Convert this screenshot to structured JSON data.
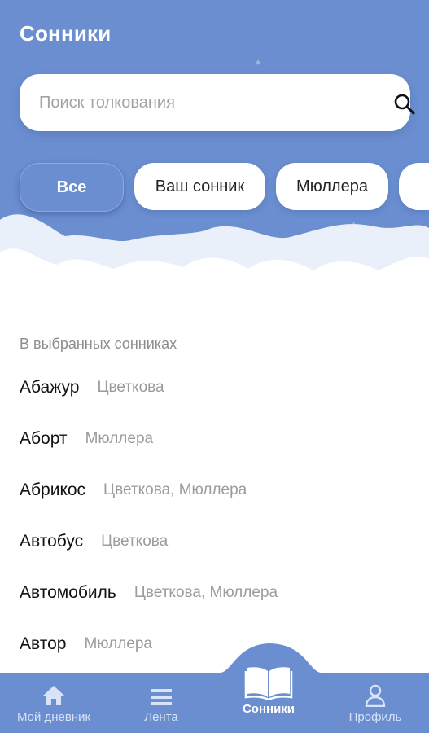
{
  "header": {
    "title": "Сонники"
  },
  "search": {
    "placeholder": "Поиск толкования",
    "icon": "search-icon"
  },
  "filters": {
    "items": [
      {
        "label": "Все",
        "active": true
      },
      {
        "label": "Ваш сонник",
        "active": false
      },
      {
        "label": "Мюллера",
        "active": false
      },
      {
        "label": "",
        "active": false
      }
    ]
  },
  "section": {
    "label": "В выбранных сонниках"
  },
  "entries": [
    {
      "word": "Абажур",
      "sources": "Цветкова"
    },
    {
      "word": "Аборт",
      "sources": "Мюллера"
    },
    {
      "word": "Абрикос",
      "sources": "Цветкова, Мюллера"
    },
    {
      "word": "Автобус",
      "sources": "Цветкова"
    },
    {
      "word": "Автомобиль",
      "sources": "Цветкова, Мюллера"
    },
    {
      "word": "Автор",
      "sources": "Мюллера"
    }
  ],
  "nav": {
    "items": [
      {
        "label": "Мой дневник",
        "icon": "home-icon",
        "active": false
      },
      {
        "label": "Лента",
        "icon": "feed-icon",
        "active": false
      },
      {
        "label": "Сонники",
        "icon": "book-icon",
        "active": true
      },
      {
        "label": "Профиль",
        "icon": "profile-icon",
        "active": false
      }
    ]
  },
  "colors": {
    "primary": "#6a8ed0",
    "cloud": "#ffffff",
    "cloud_shade": "#e9eef8",
    "muted_text": "#9b9b9b"
  }
}
